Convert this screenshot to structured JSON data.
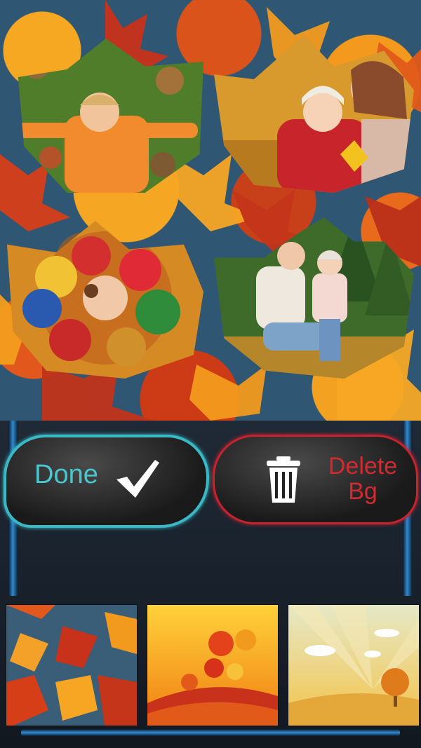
{
  "canvas": {
    "photos": [
      {
        "name": "boy-in-leaves-photo"
      },
      {
        "name": "mother-and-child-photo"
      },
      {
        "name": "kids-circle-photo"
      },
      {
        "name": "mother-daughter-forest-photo"
      }
    ]
  },
  "actions": {
    "done_label": "Done",
    "delete_label": "Delete Bg"
  },
  "colors": {
    "done_accent": "#39b8c6",
    "delete_accent": "#c5232d",
    "rail_blue": "#2f8bd2"
  },
  "backgrounds": [
    {
      "name": "maple-leaves-pattern"
    },
    {
      "name": "orange-autumn-leaves"
    },
    {
      "name": "autumn-tree-sunrays"
    }
  ]
}
